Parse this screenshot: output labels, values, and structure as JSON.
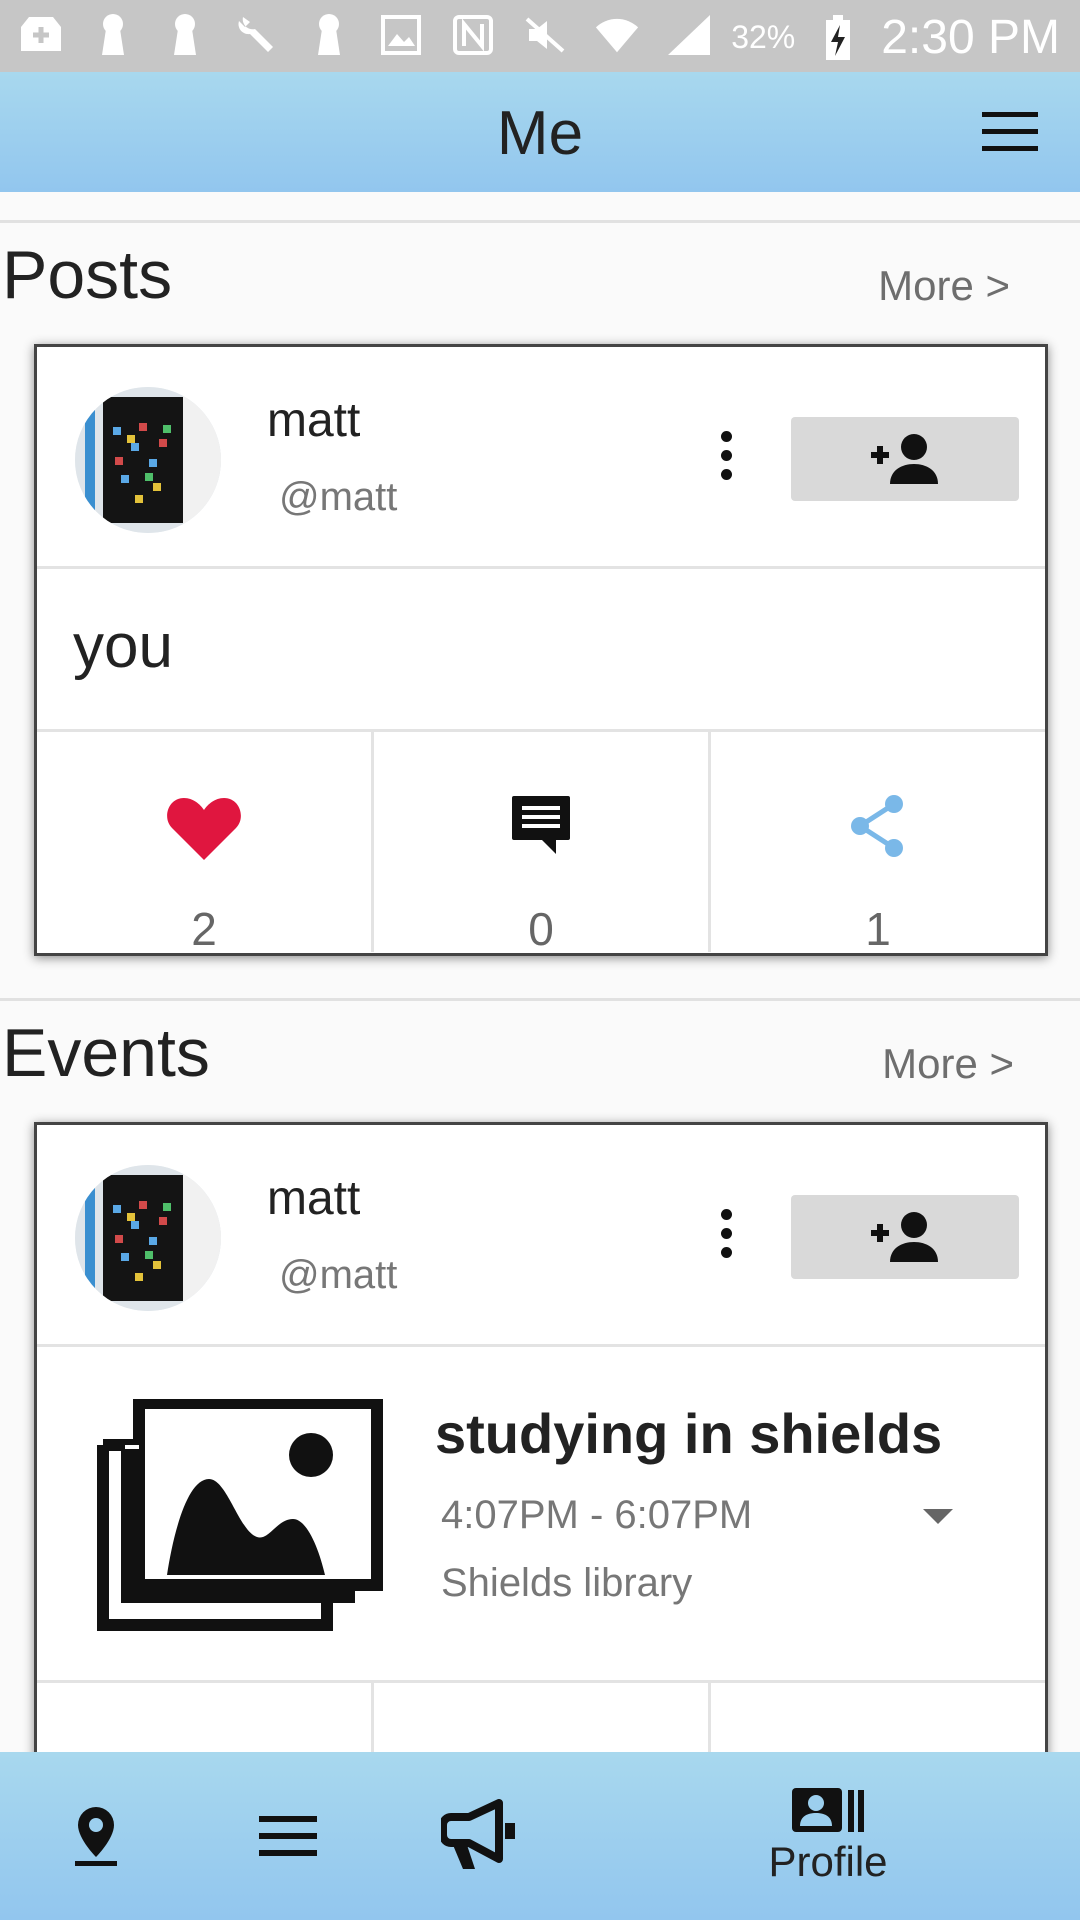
{
  "status_bar": {
    "battery": "32%",
    "time": "2:30 PM"
  },
  "app_bar": {
    "title": "Me"
  },
  "posts_section": {
    "title": "Posts",
    "more": "More >",
    "card": {
      "name": "matt",
      "handle": "@matt",
      "text": "you",
      "likes": "2",
      "comments": "0",
      "shares": "1"
    }
  },
  "events_section": {
    "title": "Events",
    "more": "More >",
    "card": {
      "name": "matt",
      "handle": "@matt",
      "event_title": "studying in shields",
      "event_time": "4:07PM - 6:07PM",
      "event_location": "Shields library"
    }
  },
  "bottom_nav": {
    "profile_label": "Profile"
  },
  "colors": {
    "app_bar": "#9ccfee",
    "like": "#e0163f",
    "share": "#7ab8e8"
  }
}
